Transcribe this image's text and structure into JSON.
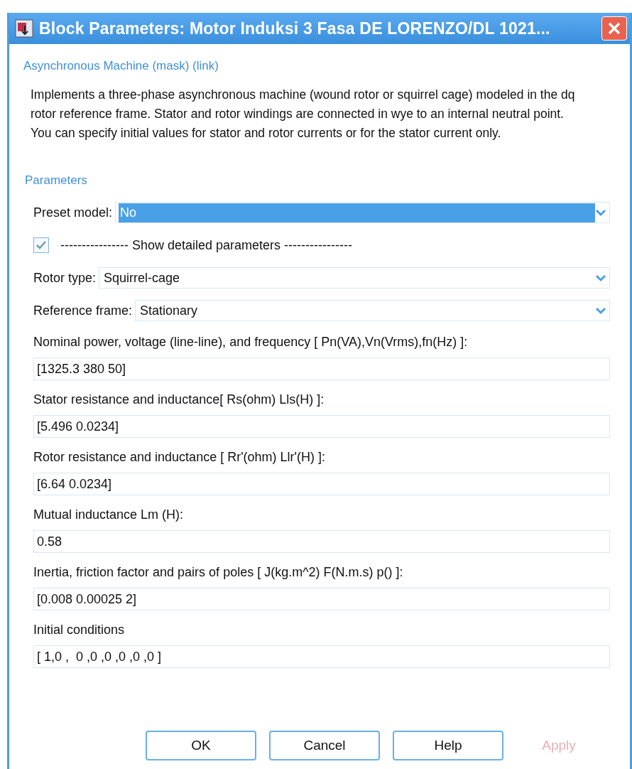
{
  "window": {
    "title": "Block Parameters: Motor Induksi 3 Fasa DE LORENZO/DL 1021..."
  },
  "mask_title": "Asynchronous Machine (mask) (link)",
  "description": "Implements a three-phase asynchronous machine (wound rotor or squirrel cage) modeled in the dq rotor reference frame. Stator and rotor windings are connected in wye to an internal neutral point. You can specify initial values for stator and rotor currents or for  the stator current only.",
  "section_title": "Parameters",
  "parameters": [
    {
      "kind": "dropdown",
      "label": "Preset model:",
      "value": "No",
      "selected": true
    },
    {
      "kind": "checkbox",
      "label": "---------------- Show detailed parameters ----------------",
      "checked": true
    },
    {
      "kind": "dropdown",
      "label": "Rotor type:",
      "value": "Squirrel-cage",
      "selected": false
    },
    {
      "kind": "dropdown",
      "label": "Reference frame:",
      "value": "Stationary",
      "selected": false
    },
    {
      "kind": "text",
      "label": "Nominal power, voltage (line-line), and frequency [ Pn(VA),Vn(Vrms),fn(Hz) ]:",
      "value": "[1325.3 380 50]"
    },
    {
      "kind": "text",
      "label": "Stator resistance and inductance[ Rs(ohm)  Lls(H) ]:",
      "value": "[5.496 0.0234]"
    },
    {
      "kind": "text",
      "label": "Rotor resistance and inductance [ Rr'(ohm)  Llr'(H) ]:",
      "value": "[6.64 0.0234]"
    },
    {
      "kind": "text",
      "label": "Mutual inductance Lm (H):",
      "value": "0.58"
    },
    {
      "kind": "text",
      "label": "Inertia, friction factor and pairs of poles [ J(kg.m^2)  F(N.m.s)  p() ]:",
      "value": "[0.008 0.00025 2]"
    },
    {
      "kind": "text",
      "label": "Initial conditions",
      "value": "[ 1,0 ,  0 ,0 ,0 ,0 ,0 ,0 ]"
    }
  ],
  "buttons": [
    {
      "label": "OK",
      "disabled": false
    },
    {
      "label": "Cancel",
      "disabled": false
    },
    {
      "label": "Help",
      "disabled": false
    },
    {
      "label": "Apply",
      "disabled": true
    }
  ]
}
